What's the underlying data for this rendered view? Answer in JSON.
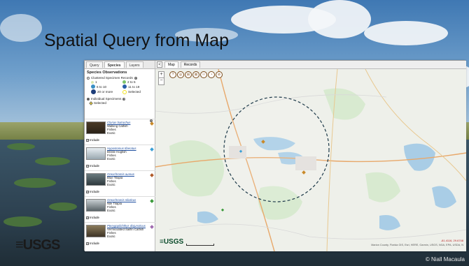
{
  "slide": {
    "title": "Spatial Query from Map",
    "watermark": "≡USGS",
    "photo_credit": "© Niall Macaula"
  },
  "left_panel": {
    "tabs": [
      {
        "label": "Query",
        "active": false
      },
      {
        "label": "Species",
        "active": true
      },
      {
        "label": "Layers",
        "active": false
      }
    ],
    "heading": "Species Observations",
    "clustered_label": "Clustered Specimen Records",
    "legend": [
      {
        "label": "1",
        "color": "#d8e8b0"
      },
      {
        "label": "2 to 5",
        "color": "#7ec46a"
      },
      {
        "label": "6 to 10",
        "color": "#3a8fc4"
      },
      {
        "label": "11 to 19",
        "color": "#2a5ea8"
      },
      {
        "label": "20 or more",
        "color": "#1e3f7a"
      },
      {
        "label": "Selected",
        "color": "#f2e21a"
      }
    ],
    "individual_label": "Individual Specimens",
    "individual_selected": "Selected",
    "species": [
      {
        "sci": "Clarias batrachus",
        "common": "Walking Catfish",
        "group": "Fishes",
        "status": "Exotic",
        "marker": "#c98a2a",
        "include": "Include"
      },
      {
        "sci": "Hypostomus tiberatus",
        "common": "Bristle Hogfish",
        "group": "Fishes",
        "status": "Exotic",
        "marker": "#3a9fd6",
        "include": "Include"
      },
      {
        "sci": "Oreochromis aureus",
        "common": "Blue Tilapia",
        "group": "Fishes",
        "status": "Exotic",
        "marker": "#b05a2a",
        "include": "Include"
      },
      {
        "sci": "Oreochromis niloticus",
        "common": "Nile Tilapia",
        "group": "Fishes",
        "status": "Exotic",
        "marker": "#3a9a3a",
        "include": "Include"
      },
      {
        "sci": "Pterygoplichthys disjunctivus",
        "common": "Vermiculated Sailfin Catfish",
        "group": "Fishes",
        "status": "Exotic",
        "marker": "#a06ab0",
        "include": "Include"
      }
    ]
  },
  "map_panel": {
    "collapse_label": "<",
    "tabs": [
      {
        "label": "Map",
        "active": true
      },
      {
        "label": "Records",
        "active": false
      }
    ],
    "zoom_in": "+",
    "zoom_out": "−",
    "tools": [
      "?",
      "◎",
      "⊞",
      "⊠",
      "☉",
      "◔",
      "⊘"
    ],
    "logo": "≡USGS",
    "coords": "-81.4116, 29.6748",
    "attribution": "Marion County, Florida GIS, Esri, HERE, Garmin, USGS, NGA, EPA, USDA, N"
  }
}
